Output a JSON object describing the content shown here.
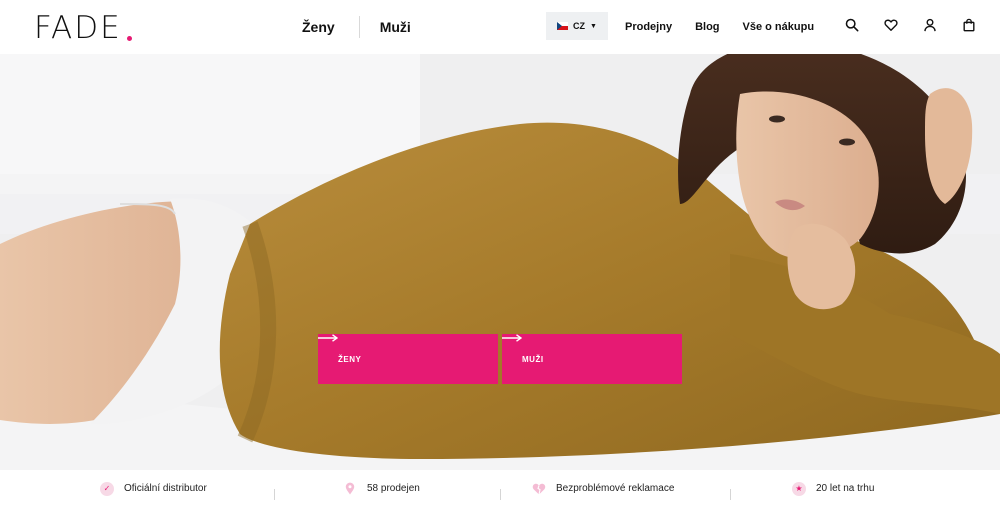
{
  "brand": {
    "name": "FADE",
    "dot_color": "#e61a73"
  },
  "nav": {
    "gender": [
      {
        "label": "Ženy"
      },
      {
        "label": "Muži"
      }
    ],
    "language": {
      "code": "CZ",
      "flag": "czech-flag-icon"
    },
    "links": [
      {
        "label": "Prodejny"
      },
      {
        "label": "Blog"
      },
      {
        "label": "Vše o nákupu"
      }
    ],
    "icons": [
      "search-icon",
      "heart-icon",
      "user-icon",
      "shopping-bag-icon"
    ]
  },
  "hero": {
    "accent": "#e61a73",
    "buttons": [
      {
        "label": "ŽENY",
        "icon": "arrow-right-icon"
      },
      {
        "label": "MUŽI",
        "icon": "arrow-right-icon"
      }
    ]
  },
  "benefits": [
    {
      "label": "Oficiální distributor",
      "icon": "check-icon",
      "color": "#f7d9e6"
    },
    {
      "label": "58 prodejen",
      "icon": "map-pin-icon",
      "color": "#f7d9e6"
    },
    {
      "label": "Bezproblémové reklamace",
      "icon": "broken-heart-icon",
      "color": "#f4c9dc"
    },
    {
      "label": "20 let na trhu",
      "icon": "star-icon",
      "color": "#f7d9e6"
    }
  ]
}
